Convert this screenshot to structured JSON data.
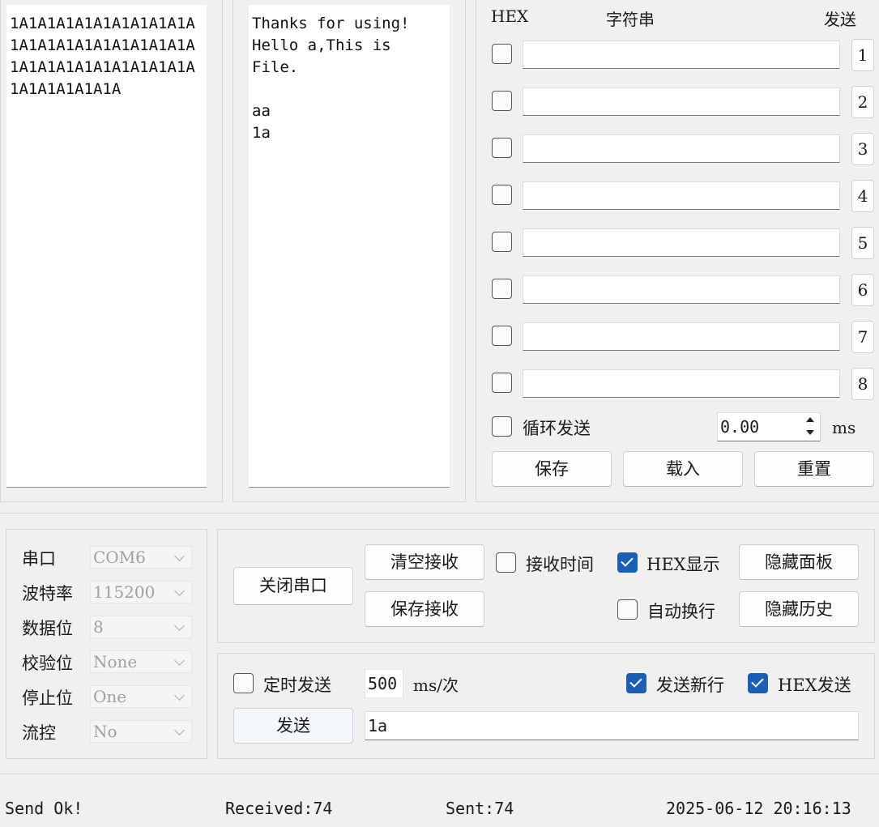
{
  "receive": {
    "text": "1A1A1A1A1A1A1A1A1A1A1A1A1A1A1A1A1A1A1A1A1A1A1A1A1A1A1A1A1A1A1A1A1A1A1A1A"
  },
  "history": {
    "text": "Thanks for using!\nHello a,This is\nFile.\n\naa\n1a"
  },
  "multi_send": {
    "header_hex": "HEX",
    "header_string": "字符串",
    "header_send": "发送",
    "rows": [
      {
        "num": "1",
        "value": ""
      },
      {
        "num": "2",
        "value": ""
      },
      {
        "num": "3",
        "value": ""
      },
      {
        "num": "4",
        "value": ""
      },
      {
        "num": "5",
        "value": ""
      },
      {
        "num": "6",
        "value": ""
      },
      {
        "num": "7",
        "value": ""
      },
      {
        "num": "8",
        "value": ""
      }
    ],
    "loop_label": "循环发送",
    "interval_value": "0.00",
    "interval_unit": "ms",
    "save_label": "保存",
    "load_label": "载入",
    "reset_label": "重置"
  },
  "port": {
    "port_label": "串口",
    "port_value": "COM6",
    "baud_label": "波特率",
    "baud_value": "115200",
    "databits_label": "数据位",
    "databits_value": "8",
    "parity_label": "校验位",
    "parity_value": "None",
    "stopbits_label": "停止位",
    "stopbits_value": "One",
    "flow_label": "流控",
    "flow_value": "No"
  },
  "controls": {
    "close_port_label": "关闭串口",
    "clear_receive_label": "清空接收",
    "save_receive_label": "保存接收",
    "recv_time_label": "接收时间",
    "hex_display_label": "HEX显示",
    "auto_wrap_label": "自动换行",
    "hide_panel_label": "隐藏面板",
    "hide_history_label": "隐藏历史"
  },
  "send": {
    "timed_label": "定时发送",
    "timed_value": "500",
    "timed_unit": "ms/次",
    "newline_label": "发送新行",
    "hex_send_label": "HEX发送",
    "send_button_label": "发送",
    "input_value": "1a"
  },
  "status": {
    "message": "Send Ok!",
    "received": "Received:74",
    "sent": "Sent:74",
    "datetime": "2025-06-12 20:16:13"
  },
  "colors": {
    "accent": "#1a5fb4",
    "background": "#f0f0f0"
  }
}
